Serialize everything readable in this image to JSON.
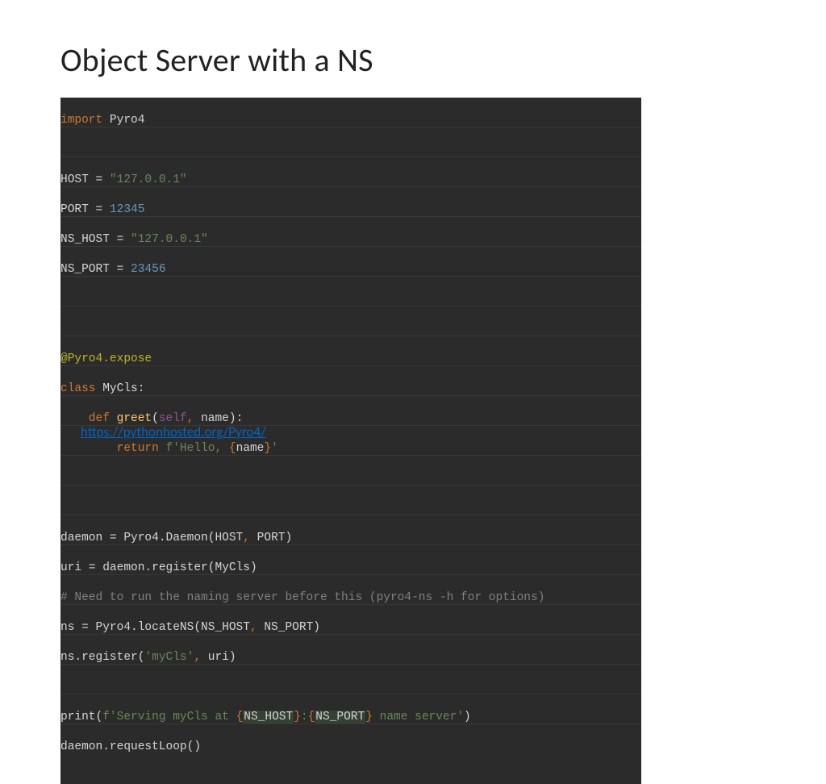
{
  "title": "Object Server with a NS",
  "link": "https://pythonhosted.org/Pyro4/",
  "code": {
    "l1_import": "import",
    "l1_mod": " Pyro4",
    "l3_host": "HOST ",
    "l3_eq": "= ",
    "l3_str": "\"127.0.0.1\"",
    "l4_port": "PORT ",
    "l4_eq": "= ",
    "l4_num": "12345",
    "l5_nshost": "NS_HOST ",
    "l5_eq": "= ",
    "l5_str": "\"127.0.0.1\"",
    "l6_nsport": "NS_PORT ",
    "l6_eq": "= ",
    "l6_num": "23456",
    "l9_dec": "@Pyro4.expose",
    "l10_class": "class ",
    "l10_name": "MyCls:",
    "l11_def": "    def ",
    "l11_fn": "greet",
    "l11_op": "(",
    "l11_self": "self",
    "l11_comma": ", ",
    "l11_arg": "name):",
    "l12_ret": "        return ",
    "l12_f": "f",
    "l12_s1": "'Hello, ",
    "l12_ob": "{",
    "l12_var": "name",
    "l12_cb": "}",
    "l12_s2": "'",
    "l15_a": "daemon ",
    "l15_eq": "= ",
    "l15_b": "Pyro4.Daemon(HOST",
    "l15_c1": ", ",
    "l15_c": "PORT)",
    "l16_a": "uri ",
    "l16_eq": "= ",
    "l16_b": "daemon.register(MyCls)",
    "l17_c": "# Need to run the naming server before this (pyro4-ns -h for options)",
    "l18_a": "ns ",
    "l18_eq": "= ",
    "l18_b": "Pyro4.locateNS(NS_HOST",
    "l18_c1": ", ",
    "l18_c": "NS_PORT)",
    "l19_a": "ns.register(",
    "l19_s": "'myCls'",
    "l19_c1": ", ",
    "l19_b": "uri)",
    "l21_p": "print",
    "l21_op": "(",
    "l21_f": "f",
    "l21_s1": "'Serving myCls at ",
    "l21_ob1": "{",
    "l21_v1": "NS_HOST",
    "l21_cb1": "}",
    "l21_col": ":",
    "l21_ob2": "{",
    "l21_v2": "NS_PORT",
    "l21_cb2": "}",
    "l21_s2": " name server'",
    "l21_cp": ")",
    "l22_a": "daemon.requestLoop()"
  }
}
